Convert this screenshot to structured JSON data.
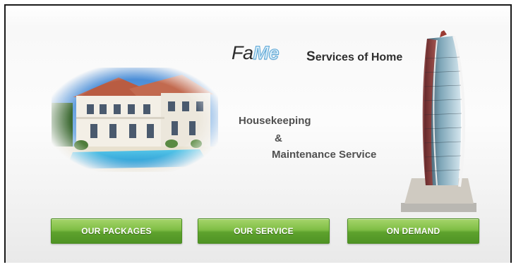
{
  "brand": {
    "logo_part1": "Fa",
    "logo_part2": "Me",
    "tagline_initial": "S",
    "tagline_rest": "ervices of Home"
  },
  "services": {
    "line1": "Housekeeping",
    "ampersand": "&",
    "line2": "Maintenance Service"
  },
  "buttons": {
    "packages": "OUR PACKAGES",
    "service": "OUR SERVICE",
    "on_demand": "ON DEMAND"
  },
  "colors": {
    "button_green": "#6fb33a",
    "logo_blue": "#5aa6d5",
    "text_gray": "#505050"
  }
}
